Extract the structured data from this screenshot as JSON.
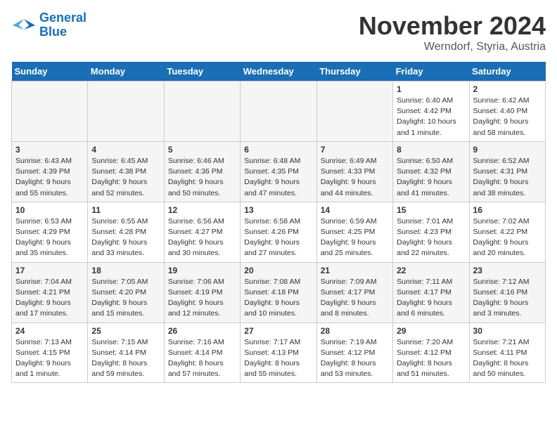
{
  "logo": {
    "line1": "General",
    "line2": "Blue"
  },
  "title": "November 2024",
  "location": "Werndorf, Styria, Austria",
  "days_of_week": [
    "Sunday",
    "Monday",
    "Tuesday",
    "Wednesday",
    "Thursday",
    "Friday",
    "Saturday"
  ],
  "weeks": [
    [
      {
        "day": "",
        "info": ""
      },
      {
        "day": "",
        "info": ""
      },
      {
        "day": "",
        "info": ""
      },
      {
        "day": "",
        "info": ""
      },
      {
        "day": "",
        "info": ""
      },
      {
        "day": "1",
        "info": "Sunrise: 6:40 AM\nSunset: 4:42 PM\nDaylight: 10 hours and 1 minute."
      },
      {
        "day": "2",
        "info": "Sunrise: 6:42 AM\nSunset: 4:40 PM\nDaylight: 9 hours and 58 minutes."
      }
    ],
    [
      {
        "day": "3",
        "info": "Sunrise: 6:43 AM\nSunset: 4:39 PM\nDaylight: 9 hours and 55 minutes."
      },
      {
        "day": "4",
        "info": "Sunrise: 6:45 AM\nSunset: 4:38 PM\nDaylight: 9 hours and 52 minutes."
      },
      {
        "day": "5",
        "info": "Sunrise: 6:46 AM\nSunset: 4:36 PM\nDaylight: 9 hours and 50 minutes."
      },
      {
        "day": "6",
        "info": "Sunrise: 6:48 AM\nSunset: 4:35 PM\nDaylight: 9 hours and 47 minutes."
      },
      {
        "day": "7",
        "info": "Sunrise: 6:49 AM\nSunset: 4:33 PM\nDaylight: 9 hours and 44 minutes."
      },
      {
        "day": "8",
        "info": "Sunrise: 6:50 AM\nSunset: 4:32 PM\nDaylight: 9 hours and 41 minutes."
      },
      {
        "day": "9",
        "info": "Sunrise: 6:52 AM\nSunset: 4:31 PM\nDaylight: 9 hours and 38 minutes."
      }
    ],
    [
      {
        "day": "10",
        "info": "Sunrise: 6:53 AM\nSunset: 4:29 PM\nDaylight: 9 hours and 35 minutes."
      },
      {
        "day": "11",
        "info": "Sunrise: 6:55 AM\nSunset: 4:28 PM\nDaylight: 9 hours and 33 minutes."
      },
      {
        "day": "12",
        "info": "Sunrise: 6:56 AM\nSunset: 4:27 PM\nDaylight: 9 hours and 30 minutes."
      },
      {
        "day": "13",
        "info": "Sunrise: 6:58 AM\nSunset: 4:26 PM\nDaylight: 9 hours and 27 minutes."
      },
      {
        "day": "14",
        "info": "Sunrise: 6:59 AM\nSunset: 4:25 PM\nDaylight: 9 hours and 25 minutes."
      },
      {
        "day": "15",
        "info": "Sunrise: 7:01 AM\nSunset: 4:23 PM\nDaylight: 9 hours and 22 minutes."
      },
      {
        "day": "16",
        "info": "Sunrise: 7:02 AM\nSunset: 4:22 PM\nDaylight: 9 hours and 20 minutes."
      }
    ],
    [
      {
        "day": "17",
        "info": "Sunrise: 7:04 AM\nSunset: 4:21 PM\nDaylight: 9 hours and 17 minutes."
      },
      {
        "day": "18",
        "info": "Sunrise: 7:05 AM\nSunset: 4:20 PM\nDaylight: 9 hours and 15 minutes."
      },
      {
        "day": "19",
        "info": "Sunrise: 7:06 AM\nSunset: 4:19 PM\nDaylight: 9 hours and 12 minutes."
      },
      {
        "day": "20",
        "info": "Sunrise: 7:08 AM\nSunset: 4:18 PM\nDaylight: 9 hours and 10 minutes."
      },
      {
        "day": "21",
        "info": "Sunrise: 7:09 AM\nSunset: 4:17 PM\nDaylight: 9 hours and 8 minutes."
      },
      {
        "day": "22",
        "info": "Sunrise: 7:11 AM\nSunset: 4:17 PM\nDaylight: 9 hours and 6 minutes."
      },
      {
        "day": "23",
        "info": "Sunrise: 7:12 AM\nSunset: 4:16 PM\nDaylight: 9 hours and 3 minutes."
      }
    ],
    [
      {
        "day": "24",
        "info": "Sunrise: 7:13 AM\nSunset: 4:15 PM\nDaylight: 9 hours and 1 minute."
      },
      {
        "day": "25",
        "info": "Sunrise: 7:15 AM\nSunset: 4:14 PM\nDaylight: 8 hours and 59 minutes."
      },
      {
        "day": "26",
        "info": "Sunrise: 7:16 AM\nSunset: 4:14 PM\nDaylight: 8 hours and 57 minutes."
      },
      {
        "day": "27",
        "info": "Sunrise: 7:17 AM\nSunset: 4:13 PM\nDaylight: 8 hours and 55 minutes."
      },
      {
        "day": "28",
        "info": "Sunrise: 7:19 AM\nSunset: 4:12 PM\nDaylight: 8 hours and 53 minutes."
      },
      {
        "day": "29",
        "info": "Sunrise: 7:20 AM\nSunset: 4:12 PM\nDaylight: 8 hours and 51 minutes."
      },
      {
        "day": "30",
        "info": "Sunrise: 7:21 AM\nSunset: 4:11 PM\nDaylight: 8 hours and 50 minutes."
      }
    ]
  ]
}
